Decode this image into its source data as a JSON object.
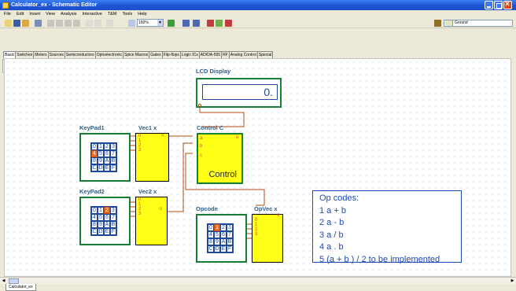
{
  "window": {
    "title": "Calculator_ex - Schematic Editor",
    "app_icon": "schematic-editor-icon"
  },
  "menu": [
    "File",
    "Edit",
    "Insert",
    "View",
    "Analysis",
    "Interactive",
    "T&M",
    "Tools",
    "Help"
  ],
  "toolbar": {
    "zoom_value": "150%",
    "ground_value": "Ground"
  },
  "tabs": [
    "Basic",
    "Switches",
    "Meters",
    "Sources",
    "Semiconductors",
    "Optoelectronic",
    "Spice Macros",
    "Gates",
    "Flip-flops",
    "Logic ICs",
    "AD/DA-555",
    "RF",
    "Analog Control",
    "Special"
  ],
  "active_tab": "Basic",
  "components": {
    "lcd": {
      "label": "LCD Display",
      "value": "0."
    },
    "keypad1": {
      "label": "KeyPad1",
      "keys": [
        "0",
        "1",
        "2",
        "3",
        "4",
        "5",
        "6",
        "7",
        "8",
        "9",
        "A",
        "B",
        "C",
        "D",
        "E",
        "F"
      ],
      "selected": "4"
    },
    "keypad2": {
      "label": "KeyPad2",
      "keys": [
        "0",
        "1",
        "2",
        "3",
        "4",
        "5",
        "6",
        "7",
        "8",
        "9",
        "A",
        "B",
        "C",
        "D",
        "E",
        "F"
      ],
      "selected": "2"
    },
    "opcode": {
      "label": "Opcode",
      "keys": [
        "0",
        "1",
        "2",
        "3",
        "4",
        "5",
        "6",
        "7",
        "8",
        "9",
        "A",
        "B",
        "C",
        "D",
        "E",
        "F"
      ],
      "selected": "1"
    },
    "vec1": {
      "label": "Vec1 x"
    },
    "vec2": {
      "label": "Vec2 x"
    },
    "opvec": {
      "label": "OpVec x"
    },
    "control": {
      "label": "Control C",
      "text": "Control",
      "pins": [
        "a",
        "b",
        "c"
      ]
    },
    "bus_pins": [
      "0",
      "1",
      "2",
      "3"
    ]
  },
  "opcodes": {
    "title": "Op codes:",
    "lines": [
      "1 a + b",
      "2 a - b",
      "3 a / b",
      "4 a . b",
      "5 (a + b ) / 2  to be implemented"
    ]
  },
  "status": {
    "sheet_tab": "Calculator_ex"
  },
  "colors": {
    "titlebar": "#1f55d6",
    "component_border": "#168034",
    "component_fill": "#ffff18",
    "label": "#2c5d8a",
    "wire": "#b34b12",
    "text_blue": "#1f4ab5",
    "key_selected": "#f26b18"
  }
}
